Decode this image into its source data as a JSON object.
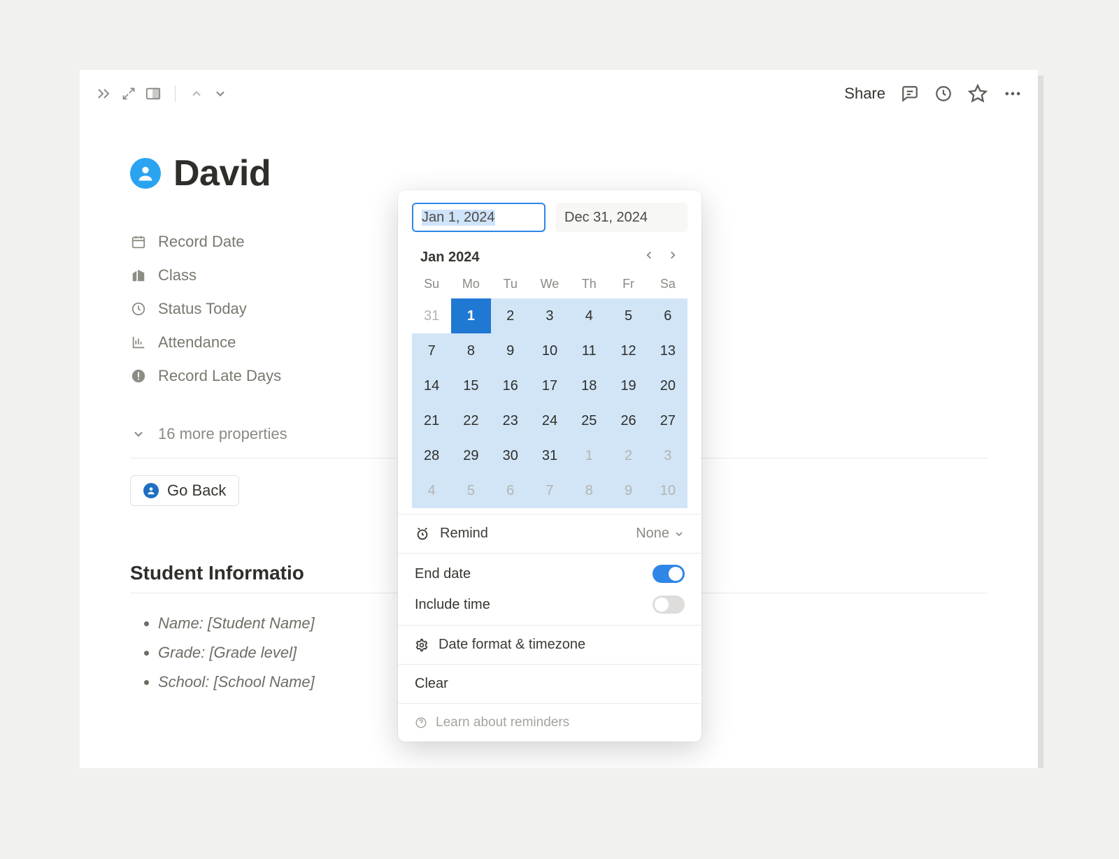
{
  "topbar": {
    "share": "Share"
  },
  "page": {
    "title": "David"
  },
  "properties": [
    {
      "icon": "calendar",
      "label": "Record Date"
    },
    {
      "icon": "building",
      "label": "Class"
    },
    {
      "icon": "clock",
      "label": "Status Today"
    },
    {
      "icon": "chart",
      "label": "Attendance"
    },
    {
      "icon": "alert",
      "label": "Record Late Days"
    }
  ],
  "more_properties_label": "16 more properties",
  "go_back_label": "Go Back",
  "section_heading": "Student Informatio",
  "info_items": [
    "Name: [Student Name]",
    "Grade: [Grade level]",
    "School: [School Name]"
  ],
  "datepicker": {
    "start_input": "Jan 1, 2024",
    "end_input": "Dec 31, 2024",
    "month_label": "Jan 2024",
    "day_headers": [
      "Su",
      "Mo",
      "Tu",
      "We",
      "Th",
      "Fr",
      "Sa"
    ],
    "weeks": [
      [
        {
          "n": "31",
          "muted": true
        },
        {
          "n": "1",
          "selected": true,
          "range": true
        },
        {
          "n": "2",
          "range": true
        },
        {
          "n": "3",
          "range": true
        },
        {
          "n": "4",
          "range": true
        },
        {
          "n": "5",
          "range": true
        },
        {
          "n": "6",
          "range": true
        }
      ],
      [
        {
          "n": "7",
          "range": true
        },
        {
          "n": "8",
          "range": true
        },
        {
          "n": "9",
          "range": true
        },
        {
          "n": "10",
          "range": true
        },
        {
          "n": "11",
          "range": true
        },
        {
          "n": "12",
          "range": true
        },
        {
          "n": "13",
          "range": true
        }
      ],
      [
        {
          "n": "14",
          "range": true
        },
        {
          "n": "15",
          "range": true
        },
        {
          "n": "16",
          "range": true
        },
        {
          "n": "17",
          "range": true
        },
        {
          "n": "18",
          "range": true
        },
        {
          "n": "19",
          "range": true
        },
        {
          "n": "20",
          "range": true
        }
      ],
      [
        {
          "n": "21",
          "range": true
        },
        {
          "n": "22",
          "range": true
        },
        {
          "n": "23",
          "range": true
        },
        {
          "n": "24",
          "range": true
        },
        {
          "n": "25",
          "range": true
        },
        {
          "n": "26",
          "range": true
        },
        {
          "n": "27",
          "range": true
        }
      ],
      [
        {
          "n": "28",
          "range": true
        },
        {
          "n": "29",
          "range": true
        },
        {
          "n": "30",
          "range": true
        },
        {
          "n": "31",
          "range": true
        },
        {
          "n": "1",
          "muted": true,
          "range": true
        },
        {
          "n": "2",
          "muted": true,
          "range": true
        },
        {
          "n": "3",
          "muted": true,
          "range": true
        }
      ],
      [
        {
          "n": "4",
          "muted": true,
          "range": true
        },
        {
          "n": "5",
          "muted": true,
          "range": true
        },
        {
          "n": "6",
          "muted": true,
          "range": true
        },
        {
          "n": "7",
          "muted": true,
          "range": true
        },
        {
          "n": "8",
          "muted": true,
          "range": true
        },
        {
          "n": "9",
          "muted": true,
          "range": true
        },
        {
          "n": "10",
          "muted": true,
          "range": true
        }
      ]
    ],
    "remind_label": "Remind",
    "remind_value": "None",
    "end_date_label": "End date",
    "end_date_on": true,
    "include_time_label": "Include time",
    "include_time_on": false,
    "date_format_label": "Date format & timezone",
    "clear_label": "Clear",
    "learn_label": "Learn about reminders"
  }
}
